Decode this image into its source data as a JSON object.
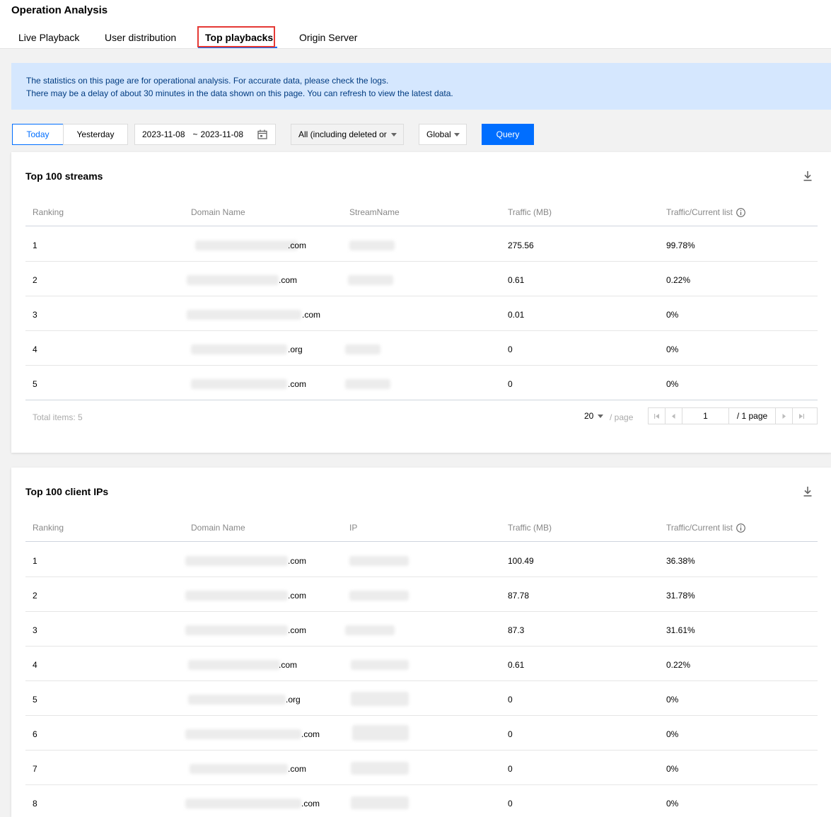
{
  "page": {
    "title": "Operation Analysis"
  },
  "tabs": [
    {
      "label": "Live Playback"
    },
    {
      "label": "User distribution"
    },
    {
      "label": "Top playbacks",
      "active": true
    },
    {
      "label": "Origin Server"
    }
  ],
  "notice": {
    "line1": "The statistics on this page are for operational analysis. For accurate data, please check the logs.",
    "line2": "There may be a delay of about 30 minutes in the data shown on this page. You can refresh to view the latest data."
  },
  "toolbar": {
    "today": "Today",
    "yesterday": "Yesterday",
    "date_start": "2023-11-08",
    "date_sep": "~",
    "date_end": "2023-11-08",
    "filter": "All (including deleted or",
    "region": "Global",
    "query": "Query"
  },
  "streams": {
    "title": "Top 100 streams",
    "columns": [
      "Ranking",
      "Domain Name",
      "StreamName",
      "Traffic (MB)",
      "Traffic/Current list"
    ],
    "rows": [
      {
        "rank": "1",
        "domain": ".com",
        "traffic": "275.56",
        "share": "99.78%"
      },
      {
        "rank": "2",
        "domain": ".com",
        "traffic": "0.61",
        "share": "0.22%"
      },
      {
        "rank": "3",
        "domain": ".com",
        "traffic": "0.01",
        "share": "0%"
      },
      {
        "rank": "4",
        "domain": ".org",
        "traffic": "0",
        "share": "0%"
      },
      {
        "rank": "5",
        "domain": ".com",
        "traffic": "0",
        "share": "0%"
      }
    ],
    "total": "Total items: 5",
    "page_size": "20",
    "page_unit": "/ page",
    "page_current": "1",
    "page_total": "/ 1 page"
  },
  "clients": {
    "title": "Top 100 client IPs",
    "columns": [
      "Ranking",
      "Domain Name",
      "IP",
      "Traffic (MB)",
      "Traffic/Current list"
    ],
    "rows": [
      {
        "rank": "1",
        "domain": ".com",
        "traffic": "100.49",
        "share": "36.38%"
      },
      {
        "rank": "2",
        "domain": ".com",
        "traffic": "87.78",
        "share": "31.78%"
      },
      {
        "rank": "3",
        "domain": ".com",
        "traffic": "87.3",
        "share": "31.61%"
      },
      {
        "rank": "4",
        "domain": ".com",
        "traffic": "0.61",
        "share": "0.22%"
      },
      {
        "rank": "5",
        "domain": ".org",
        "traffic": "0",
        "share": "0%"
      },
      {
        "rank": "6",
        "domain": ".com",
        "traffic": "0",
        "share": "0%"
      },
      {
        "rank": "7",
        "domain": ".com",
        "traffic": "0",
        "share": "0%"
      },
      {
        "rank": "8",
        "domain": ".com",
        "traffic": "0",
        "share": "0%"
      }
    ]
  }
}
